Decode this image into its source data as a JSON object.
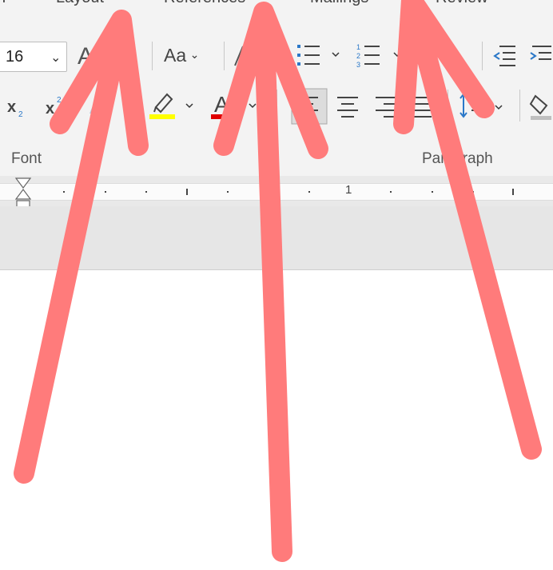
{
  "tabs": [
    {
      "label": "Layout"
    },
    {
      "label": "References"
    },
    {
      "label": "Mailings"
    },
    {
      "label": "Review"
    }
  ],
  "font": {
    "size_value": "16",
    "change_case_label": "Aa",
    "group_label": "Font"
  },
  "paragraph": {
    "group_label": "Paragraph"
  },
  "ruler": {
    "marker_label": "1"
  },
  "colors": {
    "highlight": "#ffff00",
    "font_color": "#e00000",
    "arrow": "#ff7b7b",
    "icon_blue": "#2b78c8"
  }
}
